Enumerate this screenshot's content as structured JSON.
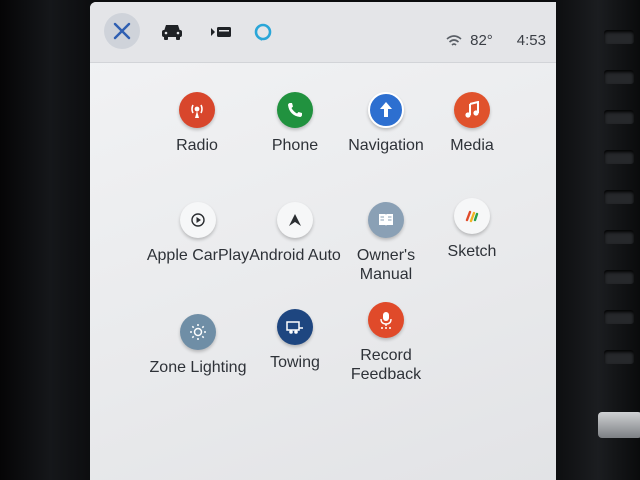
{
  "status": {
    "temperature": "82°",
    "time": "4:53",
    "icons": [
      "close-icon",
      "car-icon",
      "media-source-icon",
      "alexa-icon",
      "wifi-icon"
    ]
  },
  "colors": {
    "accent_blue": "#2f5fb2",
    "radio": "#d8462c",
    "phone": "#21923f",
    "navigation": "#2d6fd0",
    "media": "#e0522c",
    "zone_lighting": "#6f8ea6",
    "towing": "#1e4680",
    "record_feedback": "#e04a2a"
  },
  "apps": [
    {
      "label": "Radio",
      "icon": "radio-icon"
    },
    {
      "label": "Phone",
      "icon": "phone-icon"
    },
    {
      "label": "Navigation",
      "icon": "navigation-icon"
    },
    {
      "label": "Media",
      "icon": "music-note-icon"
    },
    {
      "label": "Apple CarPlay",
      "icon": "carplay-icon"
    },
    {
      "label": "Android Auto",
      "icon": "android-auto-icon"
    },
    {
      "label": "Owner's\nManual",
      "icon": "manual-book-icon"
    },
    {
      "label": "Sketch",
      "icon": "sketch-icon"
    },
    {
      "label": "Zone Lighting",
      "icon": "zone-lighting-icon"
    },
    {
      "label": "Towing",
      "icon": "trailer-icon"
    },
    {
      "label": "Record\nFeedback",
      "icon": "microphone-icon"
    }
  ]
}
